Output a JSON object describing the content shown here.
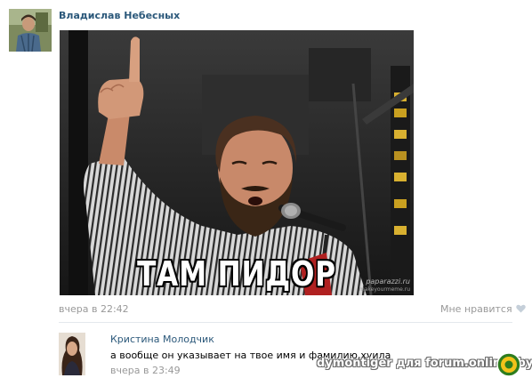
{
  "post": {
    "author": "Владислав Небесных",
    "date": "вчера в 22:42",
    "like_label": "Мне нравится",
    "photo": {
      "caption": "ТАМ ПИДОР",
      "credit": "paparazzi.ru",
      "credit2": "makeyourmeme.ru"
    }
  },
  "comment": {
    "author": "Кристина Молодчик",
    "text": "а вообще он указывает на твое имя и фамилию,хуила",
    "date": "вчера в 23:49"
  },
  "watermark": {
    "text": "dymontiger для forum.onliner.by"
  },
  "colors": {
    "link": "#2b587a",
    "muted": "#999999",
    "divider": "#e4e8ed"
  }
}
